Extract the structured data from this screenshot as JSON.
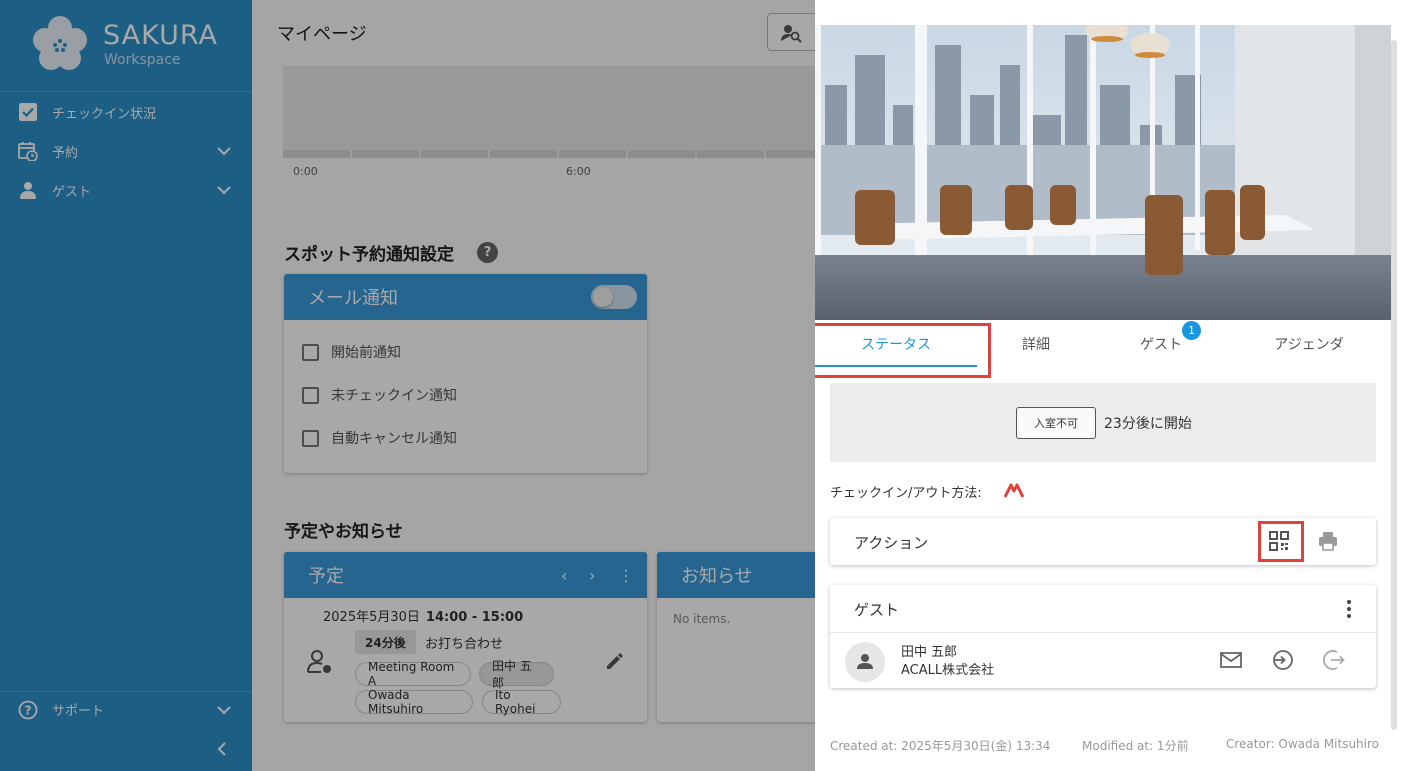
{
  "app": {
    "brand_title": "SAKURA",
    "brand_subtitle": "Workspace"
  },
  "sidebar": {
    "items": [
      {
        "label": "チェックイン状況",
        "icon": "checkbox-icon"
      },
      {
        "label": "予約",
        "icon": "calendar-clock-icon"
      },
      {
        "label": "ゲスト",
        "icon": "guest-icon"
      }
    ],
    "support_label": "サポート"
  },
  "main": {
    "page_title": "マイページ",
    "timeline_labels": [
      "0:00",
      "6:00"
    ],
    "spot_section_title": "スポット予約通知設定",
    "mail_card": {
      "title": "メール通知",
      "toggle_on": false,
      "options": [
        "開始前通知",
        "未チェックイン通知",
        "自動キャンセル通知"
      ]
    },
    "news_section_title": "予定やお知らせ",
    "schedule_card": {
      "title": "予定",
      "date": "2025年5月30日",
      "time": "14:00 - 15:00",
      "remaining": "24分後",
      "subject": "お打ち合わせ",
      "chips": [
        "Meeting Room A",
        "田中 五郎",
        "Owada Mitsuhiro",
        "Ito Ryohei"
      ]
    },
    "notice_card": {
      "title": "お知らせ",
      "empty_text": "No items."
    }
  },
  "drawer": {
    "tabs": [
      {
        "label": "ステータス",
        "active": true
      },
      {
        "label": "詳細",
        "active": false
      },
      {
        "label": "ゲスト",
        "active": false,
        "badge": "1"
      },
      {
        "label": "アジェンダ",
        "active": false
      }
    ],
    "status": {
      "pill": "入室不可",
      "text": "23分後に開始"
    },
    "checkin_method_label": "チェックイン/アウト方法:",
    "actions_panel": {
      "title": "アクション",
      "buttons": [
        "qr-code-icon",
        "print-icon"
      ]
    },
    "guest_panel": {
      "title": "ゲスト",
      "guest_name": "田中 五郎",
      "guest_company": "ACALL株式会社",
      "row_actions": [
        "mail-icon",
        "check-in-icon",
        "check-out-icon"
      ]
    },
    "footer": {
      "created": "Created at: 2025年5月30日(金) 13:34",
      "modified": "Modified at: 1分前",
      "creator": "Creator: Owada Mitsuhiro"
    }
  },
  "colors": {
    "sidebar": "#2d8fc9",
    "accent": "#2196d8",
    "card_header": "#3a9ad9",
    "highlight": "#e2403b",
    "badge": "#1a95e0"
  }
}
